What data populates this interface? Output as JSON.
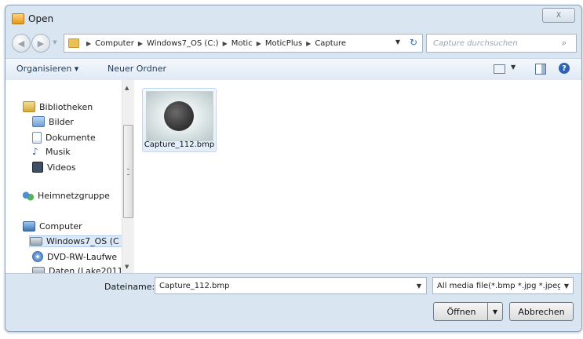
{
  "window": {
    "title": "Open",
    "close_glyph": "X"
  },
  "address_bar": {
    "breadcrumbs": [
      "Computer",
      "Windows7_OS (C:)",
      "Motic",
      "MoticPlus",
      "Capture"
    ]
  },
  "search": {
    "placeholder": "Capture durchsuchen"
  },
  "toolbar": {
    "organize": "Organisieren ▾",
    "new_folder": "Neuer Ordner"
  },
  "sidebar": {
    "libraries": "Bibliotheken",
    "pictures": "Bilder",
    "documents": "Dokumente",
    "music": "Musik",
    "videos": "Videos",
    "homegroup": "Heimnetzgruppe",
    "computer": "Computer",
    "drive_c": "Windows7_OS (C",
    "dvd": "DVD-RW-Laufwe",
    "drive_d": "Daten (Lake2011"
  },
  "files": [
    {
      "name": "Capture_112.bmp",
      "icon": "microscope-image-thumbnail"
    }
  ],
  "filename": {
    "label": "Dateiname:",
    "value": "Capture_112.bmp"
  },
  "filter": {
    "value": "All media file(*.bmp *.jpg *.jpeg"
  },
  "buttons": {
    "open": "Öffnen",
    "cancel": "Abbrechen"
  }
}
